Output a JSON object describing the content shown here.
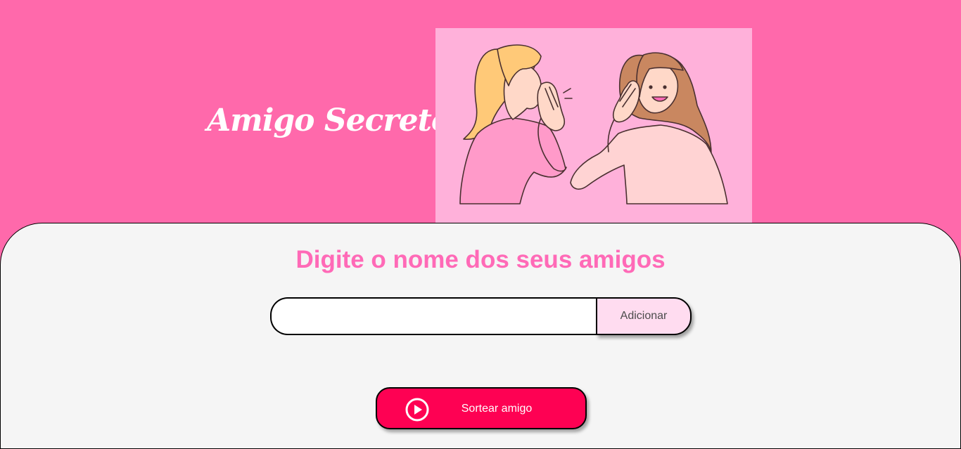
{
  "header": {
    "title": "Amigo Secreto",
    "illustration": "two-women-whispering-illustration"
  },
  "main": {
    "subtitle": "Digite o nome dos seus amigos",
    "name_input": {
      "value": "",
      "placeholder": ""
    },
    "add_button_label": "Adicionar",
    "draw_button": {
      "label": "Sortear amigo",
      "icon": "play-circle-icon"
    }
  },
  "colors": {
    "header_background": "#ff69ab",
    "illustration_background": "#ffb1da",
    "panel_background": "#f5f5f5",
    "subtitle": "#ff6ab7",
    "add_button_background": "#ffdcf0",
    "draw_button_background": "#fe0153"
  }
}
